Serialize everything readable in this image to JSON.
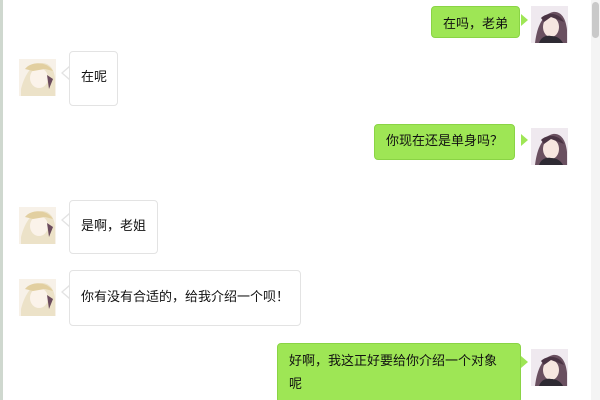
{
  "chat": {
    "messages": [
      {
        "sender": "me",
        "text": "在吗，老弟",
        "avatar": "me-avatar-icon"
      },
      {
        "sender": "them",
        "text": "在呢",
        "avatar": "friend-avatar-icon"
      },
      {
        "sender": "me",
        "text": "你现在还是单身吗？",
        "avatar": "me-avatar-icon"
      },
      {
        "sender": "them",
        "text": "是啊，老姐",
        "avatar": "friend-avatar-icon"
      },
      {
        "sender": "them",
        "text": "你有没有合适的，给我介绍一个呗！",
        "avatar": "friend-avatar-icon"
      },
      {
        "sender": "me",
        "text": "好啊，我这正好要给你介绍一个对象呢",
        "avatar": "me-avatar-icon"
      }
    ]
  },
  "colors": {
    "my_bubble": "#9ee655",
    "their_bubble": "#ffffff",
    "background": "#ffffff"
  }
}
